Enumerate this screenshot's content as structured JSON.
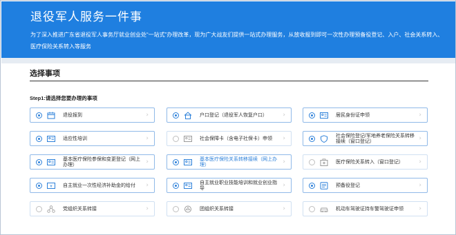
{
  "banner": {
    "title": "退役军人服务一件事",
    "desc": "为了深入推进广东省退役军人事务厅就业创业处“一站式”办理改革，现为广大战友们提供一站式办理服务，从放收报到即可一次性办理预备役登记、入户、社会关系转入、医疗保险关系转入等服务"
  },
  "section": {
    "title": "选择事项",
    "step_label": "Step1:请选择您要办理的事项"
  },
  "items": [
    {
      "label": "退役报到",
      "icon": "calendar-icon"
    },
    {
      "label": "户口登记（退役军人恢复户口）",
      "icon": "house-icon"
    },
    {
      "label": "居民身份证申领",
      "icon": "id-card-icon"
    },
    {
      "label": "适应性培训",
      "icon": "id-card-icon"
    },
    {
      "label": "社会保障卡（含电子社保卡）申领",
      "icon": "id-card-icon"
    },
    {
      "label": "社会保险登记/军地养老保险关系转移接续（窗口登记）",
      "icon": "shield-icon"
    },
    {
      "label": "基本医疗保险参保和变更登记（网上办理）",
      "icon": "id-card-icon"
    },
    {
      "label": "基本医疗保险关系转移接续（网上办理）",
      "icon": "id-card-icon"
    },
    {
      "label": "医疗保险关系转入（窗口登记）",
      "icon": "medical-kit-icon"
    },
    {
      "label": "自主就业一次性经济补助金的给付",
      "icon": "money-card-icon"
    },
    {
      "label": "自主就业职业技能培训和就业创业指导",
      "icon": "id-card-icon"
    },
    {
      "label": "预备役登记",
      "icon": "list-icon"
    },
    {
      "label": "党组织关系转接",
      "icon": "network-icon"
    },
    {
      "label": "团组织关系转接",
      "icon": "emblem-icon"
    },
    {
      "label": "机动车驾驶证持车警驾驶证申领",
      "icon": "car-icon"
    }
  ],
  "colors": {
    "banner": "#1f7fe0",
    "accent": "#2a7fd9",
    "card_border": "#8fb9e8"
  }
}
